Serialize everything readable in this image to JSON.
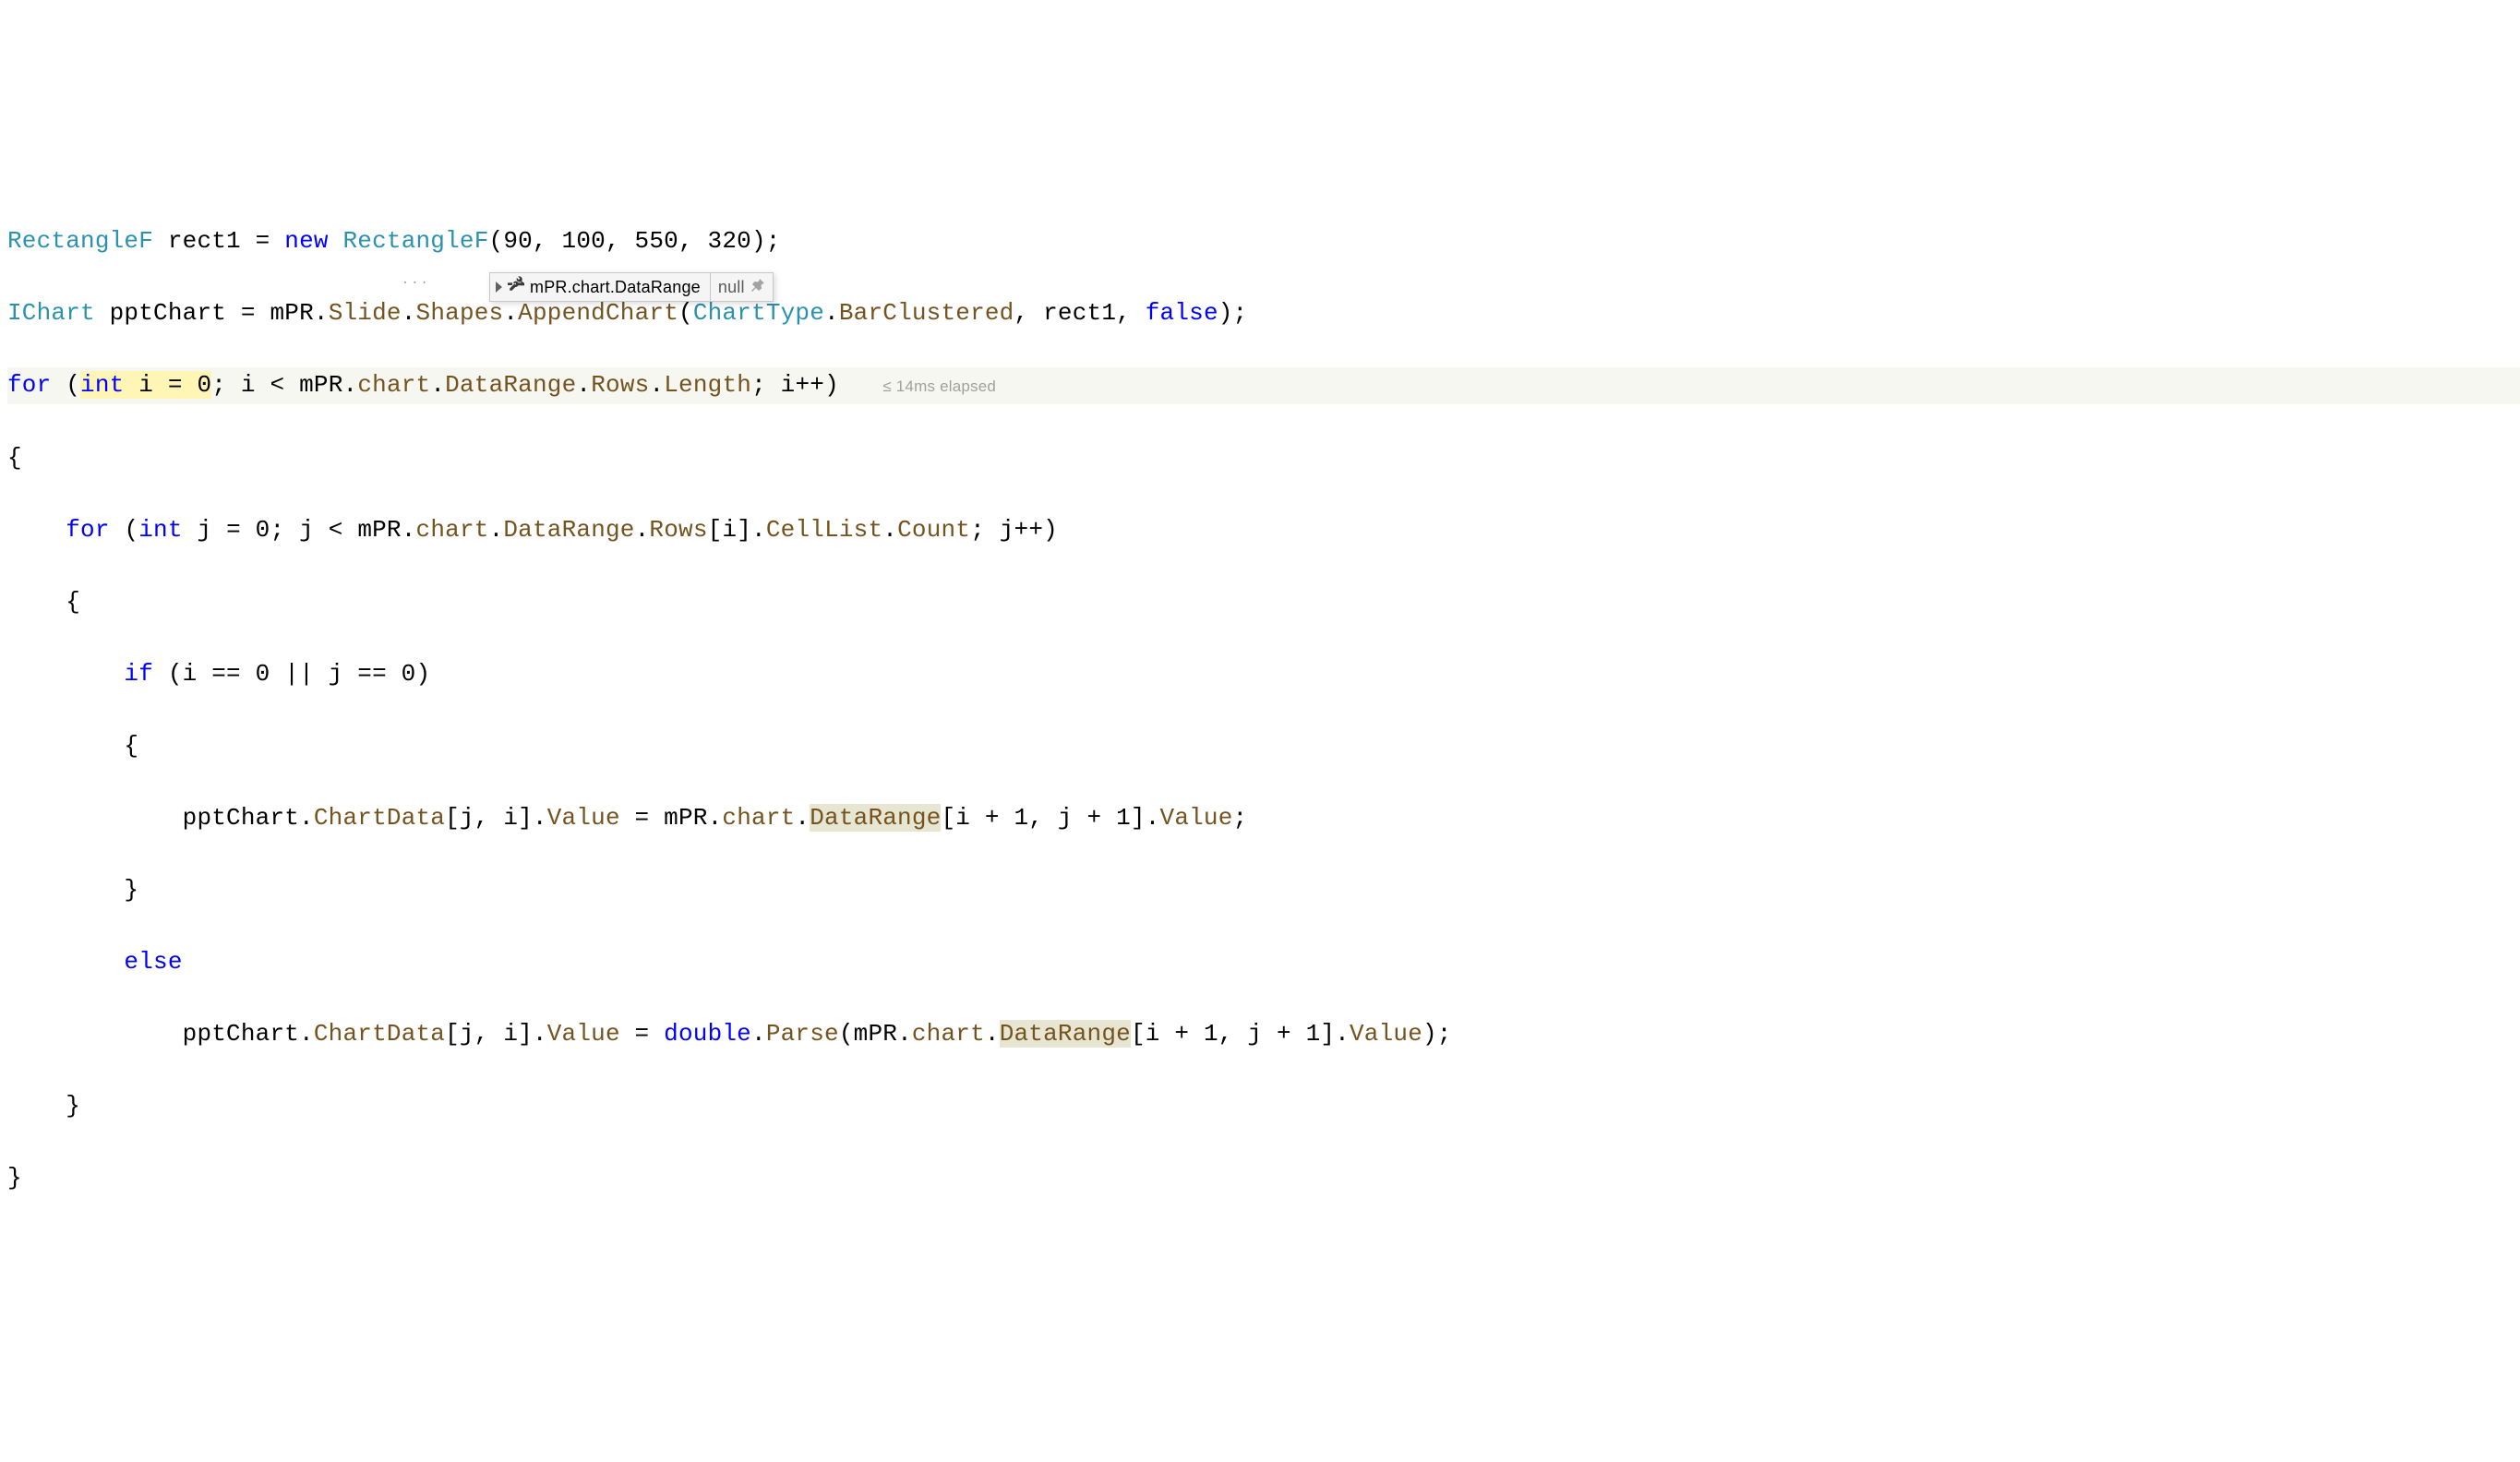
{
  "line1": {
    "type1": "RectangleF",
    "var1": " rect1 ",
    "eq": "= ",
    "kw_new": "new ",
    "type2": "RectangleF",
    "args": "(90, 100, 550, 320);"
  },
  "line2": {
    "type1": "IChart",
    "var1": " pptChart ",
    "eq": "= ",
    "obj": "mPR",
    "dot1": ".",
    "prop1": "Slide",
    "dot2": ".",
    "prop2": "Shapes",
    "dot3": ".",
    "method": "AppendChart",
    "open": "(",
    "enumtype": "ChartType",
    "dot4": ".",
    "enumval": "BarClustered",
    "rest": ", rect1, ",
    "kw_false": "false",
    "close": ");",
    "dots": "..."
  },
  "line3": {
    "kw_for": "for ",
    "open": "(",
    "kw_int": "int",
    "decl": " i = 0",
    "semi": "; i < ",
    "obj": "mPR",
    "d1": ".",
    "f1": "chart",
    "d2": ".",
    "p1": "DataRange",
    "d3": ".",
    "p2": "Rows",
    "d4": ".",
    "p3": "Length",
    "rest": "; i++)",
    "elapsed": "≤ 14ms elapsed"
  },
  "line4": "{",
  "line5": {
    "indent": "    ",
    "kw_for": "for ",
    "open": "(",
    "kw_int": "int",
    "decl": " j = 0; j < ",
    "obj": "mPR",
    "d1": ".",
    "f1": "chart",
    "d2": ".",
    "p1": "DataRange",
    "d3": ".",
    "p2": "Rows",
    "idx": "[i].",
    "p3": "CellList",
    "d4": ".",
    "p4": "Count",
    "rest": "; j++)"
  },
  "line6": "    {",
  "line7": {
    "indent": "        ",
    "kw_if": "if ",
    "cond": "(i == 0 || j == 0)"
  },
  "line8": "        {",
  "line9": {
    "indent": "            ",
    "a": "pptChart.",
    "p1": "ChartData",
    "b": "[j, i].",
    "p2": "Value",
    "c": " = ",
    "obj": "mPR",
    "d1": ".",
    "f1": "chart",
    "d2": ".",
    "dr": "DataRange",
    "idx": "[i + 1, j + 1].",
    "p3": "Value",
    "semi": ";"
  },
  "line10": "        }",
  "line11": {
    "indent": "        ",
    "kw": "else"
  },
  "line12": {
    "indent": "            ",
    "a": "pptChart.",
    "p1": "ChartData",
    "b": "[j, i].",
    "p2": "Value",
    "c": " = ",
    "kw": "double",
    "d": ".",
    "m": "Parse",
    "open": "(",
    "obj": "mPR",
    "d1": ".",
    "f1": "chart",
    "d2": ".",
    "dr": "DataRange",
    "idx": "[i + 1, j + 1].",
    "p3": "Value",
    "close": ");"
  },
  "line13": "    }",
  "line14": "}",
  "tooltip": {
    "expr": "mPR.chart.DataRange",
    "value": "null"
  }
}
